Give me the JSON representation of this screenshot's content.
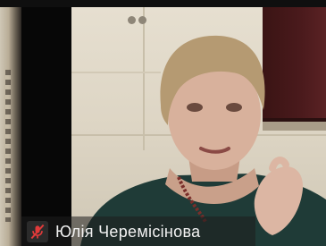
{
  "participant": {
    "name": "Юлія Черемісінова",
    "muted": true
  },
  "colors": {
    "mute_indicator": "#e03a3a",
    "label_text": "#f2f2f2",
    "label_background": "rgba(30,30,30,0.55)"
  },
  "icons": {
    "mute": "microphone-muted-icon"
  }
}
